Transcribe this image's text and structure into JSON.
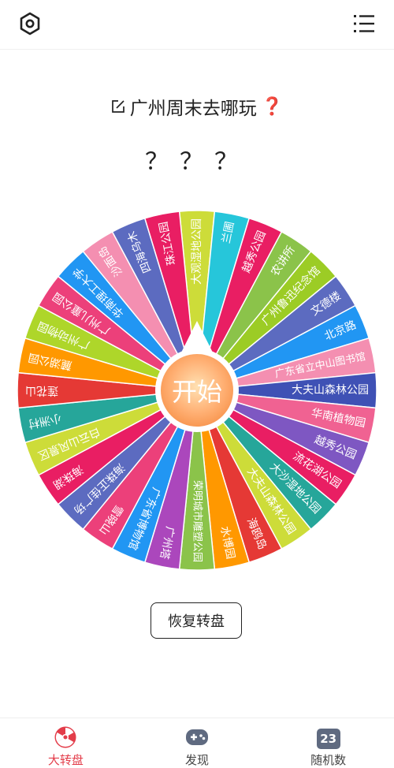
{
  "header": {
    "settings_icon": "hexagon-settings-icon",
    "menu_icon": "list-menu-icon"
  },
  "title": {
    "edit_icon": "edit-icon",
    "text": "广州周末去哪玩",
    "emoji": "❓"
  },
  "result_text": "？？？",
  "wheel": {
    "center_label": "开始",
    "segments": [
      {
        "label": "大观湿地公园",
        "color": "#cddc39"
      },
      {
        "label": "兰圃",
        "color": "#26c6da"
      },
      {
        "label": "越秀公园",
        "color": "#e91e63"
      },
      {
        "label": "农讲所",
        "color": "#8bc34a"
      },
      {
        "label": "广州鲁迅纪念馆",
        "color": "#9ccc25"
      },
      {
        "label": "文德楼",
        "color": "#5c6bc0"
      },
      {
        "label": "北京路",
        "color": "#2196f3"
      },
      {
        "label": "广东省立中山图书馆",
        "color": "#f48fb1"
      },
      {
        "label": "大夫山森林公园",
        "color": "#3f51b5"
      },
      {
        "label": "华南植物园",
        "color": "#f06292"
      },
      {
        "label": "越秀公园",
        "color": "#7e57c2"
      },
      {
        "label": "流花湖公园",
        "color": "#e91e63"
      },
      {
        "label": "大沙湿地公园",
        "color": "#26a69a"
      },
      {
        "label": "大夫山森林公园",
        "color": "#cddc39"
      },
      {
        "label": "海鸥岛",
        "color": "#e53935"
      },
      {
        "label": "水博园",
        "color": "#ff9800"
      },
      {
        "label": "荣明城市雕塑公园",
        "color": "#8bc34a"
      },
      {
        "label": "广州塔",
        "color": "#ab47bc"
      },
      {
        "label": "广东省博物馆",
        "color": "#2196f3"
      },
      {
        "label": "雪晓山",
        "color": "#ec407a"
      },
      {
        "label": "海珠正佳广场",
        "color": "#5c6bc0"
      },
      {
        "label": "海珠湖",
        "color": "#e91e63"
      },
      {
        "label": "白云山风景区",
        "color": "#cddc39"
      },
      {
        "label": "小洲村",
        "color": "#26a69a"
      },
      {
        "label": "莲花山",
        "color": "#e53935"
      },
      {
        "label": "麓湖公园",
        "color": "#ff9800"
      },
      {
        "label": "广州动物园",
        "color": "#aed62a"
      },
      {
        "label": "广州儿童公园",
        "color": "#ec407a"
      },
      {
        "label": "华南理工大学",
        "color": "#2196f3"
      },
      {
        "label": "沙面岛",
        "color": "#f48fb1"
      },
      {
        "label": "四海乌木",
        "color": "#5c6bc0"
      },
      {
        "label": "珠江公园",
        "color": "#e91e63"
      }
    ]
  },
  "reset_button": "恢复转盘",
  "nav": {
    "items": [
      {
        "label": "大转盘",
        "icon": "wheel-icon"
      },
      {
        "label": "发现",
        "icon": "gamepad-icon"
      },
      {
        "label": "随机数",
        "icon": "number-icon",
        "badge": "23"
      }
    ]
  }
}
